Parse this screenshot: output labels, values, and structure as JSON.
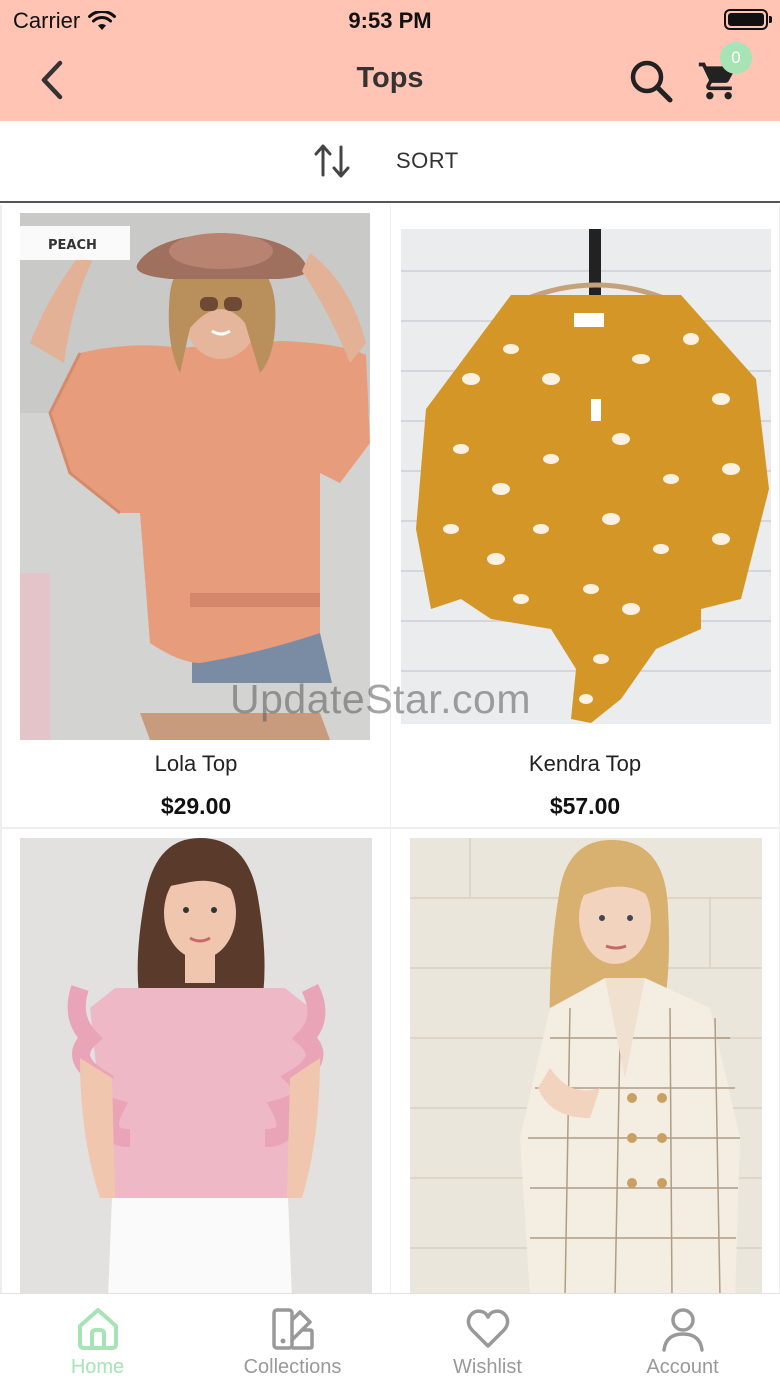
{
  "status_bar": {
    "carrier": "Carrier",
    "time": "9:53 PM"
  },
  "nav": {
    "title": "Tops",
    "back_icon": "chevron-left-icon",
    "search_icon": "search-icon",
    "cart_icon": "cart-icon",
    "cart_count": "0"
  },
  "sort": {
    "label": "SORT",
    "icon": "sort-arrows-icon"
  },
  "products": [
    {
      "name": "Lola Top",
      "price": "$29.00",
      "photo_tag": "PEACH"
    },
    {
      "name": "Kendra Top",
      "price": "$57.00"
    },
    {
      "name": "",
      "price": ""
    },
    {
      "name": "",
      "price": ""
    }
  ],
  "watermark": "UpdateStar.com",
  "tabs": [
    {
      "label": "Home",
      "icon": "home-icon",
      "active": true
    },
    {
      "label": "Collections",
      "icon": "collections-icon"
    },
    {
      "label": "Wishlist",
      "icon": "heart-icon"
    },
    {
      "label": "Account",
      "icon": "user-icon"
    }
  ],
  "colors": {
    "header_bg": "#ffc4b3",
    "accent": "#a6e3b5",
    "inactive": "#999999"
  }
}
